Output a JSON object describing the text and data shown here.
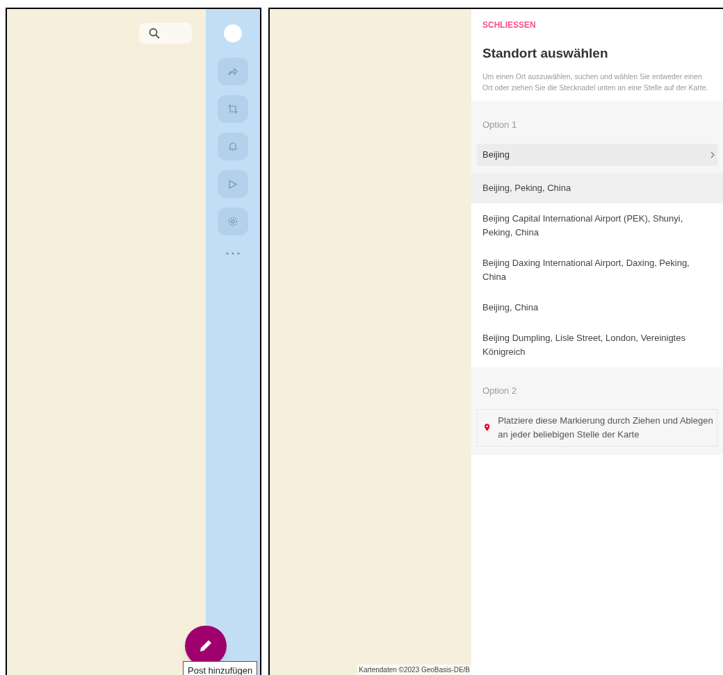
{
  "left_panel": {
    "tooltip": "Post hinzufügen"
  },
  "right_panel": {
    "map_attribution": "Kartendaten ©2023 GeoBasis-DE/B",
    "close_link": "SCHLIESSEN",
    "title": "Standort auswählen",
    "description": "Um einen Ort auszuwählen, suchen und wählen Sie entweder einen Ort oder ziehen Sie die Stecknadel unten an eine Stelle auf der Karte.",
    "option_1": {
      "label": "Option 1",
      "search_value": "Beijing",
      "suggestions": [
        {
          "text": "Beijing, Peking, China",
          "selected": true
        },
        {
          "text": "Beijing Capital International Airport (PEK), Shunyi, Peking, China",
          "selected": false
        },
        {
          "text": "Beijing Daxing International Airport, Daxing, Peking, China",
          "selected": false
        },
        {
          "text": "Beijing, China",
          "selected": false
        },
        {
          "text": "Beijing Dumpling, Lisle Street, London, Vereinigtes Königreich",
          "selected": false
        }
      ]
    },
    "option_2": {
      "label": "Option 2",
      "marker_hint": "Platziere diese Markierung durch Ziehen und Ablegen an jeder beliebigen Stelle der Karte"
    }
  }
}
